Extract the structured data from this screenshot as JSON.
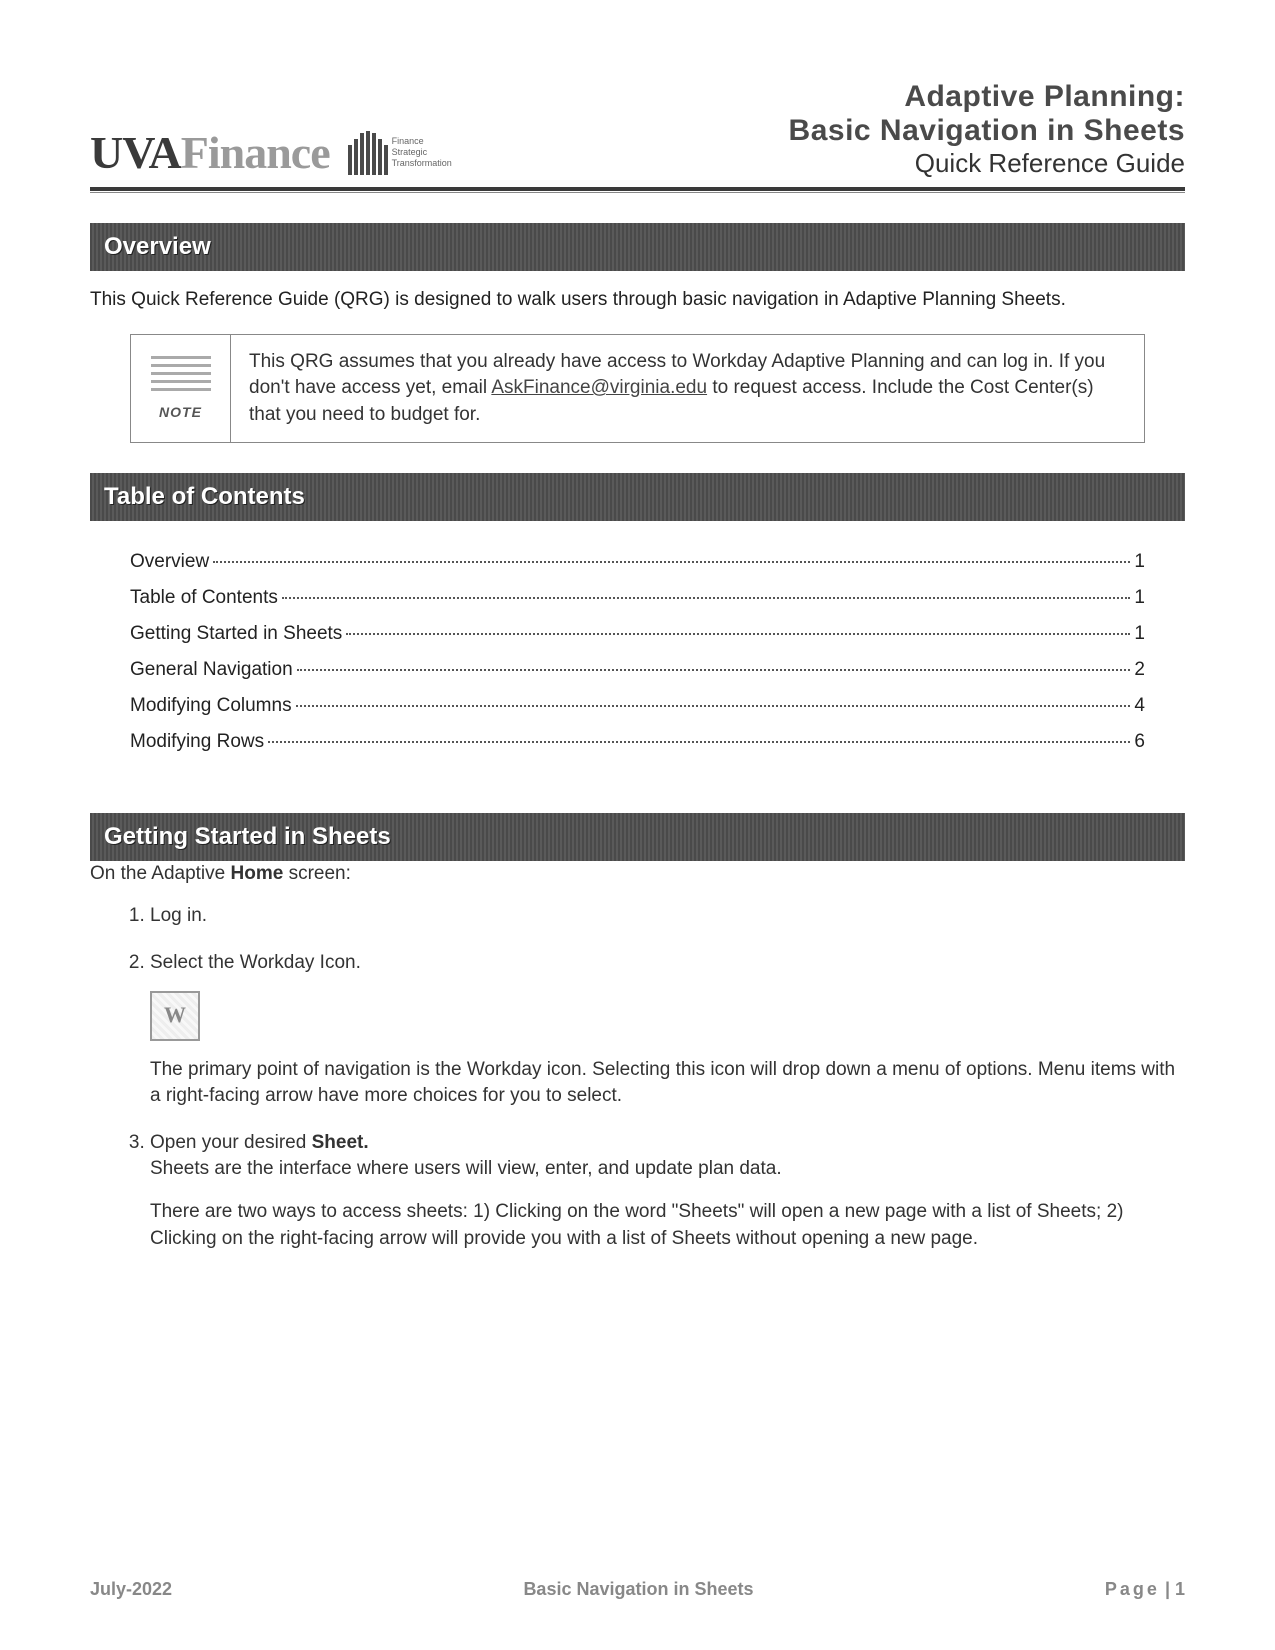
{
  "header": {
    "logo_prefix": "UVA",
    "logo_suffix": "Finance",
    "logo_sub1": "Finance",
    "logo_sub2": "Strategic",
    "logo_sub3": "Transformation",
    "title_line1": "Adaptive Planning:",
    "title_line2": "Basic Navigation in Sheets",
    "title_line3": "Quick Reference Guide"
  },
  "sections": {
    "overview_title": "Overview",
    "overview_body": "This Quick Reference Guide (QRG) is designed to walk users through basic navigation in Adaptive Planning Sheets.",
    "note_label": "NOTE",
    "note_body_a": "This QRG assumes that you already have access to Workday Adaptive Planning and can log in.  If you don't have access yet, email ",
    "note_email": "AskFinance@virginia.edu",
    "note_body_b": " to request access. Include the Cost Center(s) that you need to budget for.",
    "toc_title": "Table of Contents",
    "getting_started_title": "Getting Started in Sheets",
    "getting_started_intro_a": "On the Adaptive ",
    "getting_started_intro_b": "Home",
    "getting_started_intro_c": " screen:"
  },
  "toc": [
    {
      "label": "Overview",
      "page": "1"
    },
    {
      "label": "Table of Contents",
      "page": "1"
    },
    {
      "label": "Getting Started in Sheets",
      "page": "1"
    },
    {
      "label": "General Navigation",
      "page": "2"
    },
    {
      "label": "Modifying Columns",
      "page": "4"
    },
    {
      "label": "Modifying Rows",
      "page": "6"
    }
  ],
  "steps": {
    "s1": "Log in.",
    "s2": "Select the Workday Icon.",
    "s2_body": "The primary point of navigation is the Workday icon.  Selecting this icon will drop down a menu of options. Menu items with a right-facing arrow have more choices for you to select.",
    "s3_a": "Open your desired ",
    "s3_b": "Sheet.",
    "s3_body1": "Sheets are the interface where users will view, enter, and update plan data.",
    "s3_body2": "There are two ways to access sheets: 1) Clicking on the word \"Sheets\" will open a new page with a list of Sheets; 2) Clicking on the right-facing arrow will provide you with a list of Sheets without opening a new page."
  },
  "footer": {
    "left": "July-2022",
    "center": "Basic Navigation in Sheets",
    "right_label": "Page",
    "right_sep": " | ",
    "right_num": "1"
  }
}
